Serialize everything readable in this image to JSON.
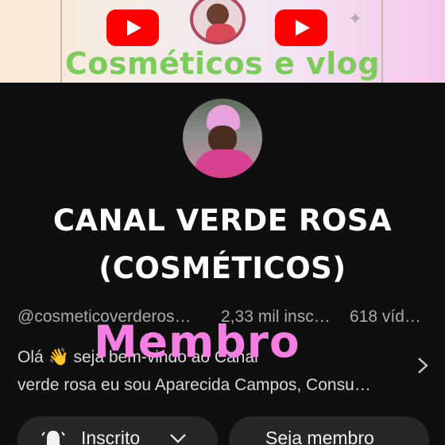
{
  "banner": {
    "title": "Cosméticos e vlog",
    "accent_title": "#7ccb5b",
    "icons": [
      "youtube-play-icon",
      "youtube-play-icon",
      "sparkle-icon"
    ]
  },
  "channel": {
    "name_line1": "CANAL VERDE ROSA",
    "name_line2": "(COSMÉTICOS)",
    "handle": "@cosmeticoverderos…",
    "subscribers": "2,33 mil insc…",
    "videos": "618 víd…",
    "description_line1": "Olá 👋 seja bem-vindo ao Canal",
    "description_line2": "verde rosa eu sou Aparecida Campos, Consu…"
  },
  "overlay": {
    "text": "Membro",
    "color": "#f57ee3"
  },
  "buttons": {
    "subscribed_label": "Inscrito",
    "member_label": "Seja membro"
  },
  "colors": {
    "background": "#0f0f0f",
    "button_bg": "#272727",
    "youtube_red": "#ff0000"
  }
}
